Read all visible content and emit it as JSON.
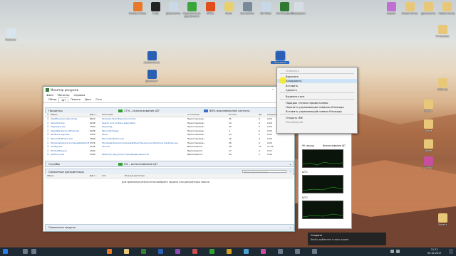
{
  "desktop_icons_top": [
    {
      "label": "Корзина",
      "color": "#9aa6b2"
    },
    {
      "label": "Mozilla Firefox",
      "color": "#e8782a"
    },
    {
      "label": "7-Zip",
      "color": "#222222"
    },
    {
      "label": "Документы",
      "color": "#c9d9e8"
    },
    {
      "label": "Подключение удалённого",
      "color": "#3aa53a"
    },
    {
      "label": "Office",
      "color": "#e24e1b"
    },
    {
      "label": "Кино",
      "color": "#e8d070"
    },
    {
      "label": "Настройки",
      "color": "#7a8a9a"
    },
    {
      "label": "HD Video",
      "color": "#c8d8e8"
    },
    {
      "label": "Фотографии",
      "color": "#2f7a2f"
    },
    {
      "label": "Проводник",
      "color": "#d7dde4"
    },
    {
      "label": "Copilot",
      "color": "#c070d0"
    },
    {
      "label": "Новая папка",
      "color": "#e8c878"
    },
    {
      "label": "Документы",
      "color": "#e8c878"
    },
    {
      "label": "Новая папка",
      "color": "#e8c878"
    }
  ],
  "desktop_icons_right": [
    {
      "label": "Установка",
      "color": "#e8c878"
    },
    {
      "label": "Рабочая",
      "color": "#e8c878"
    },
    {
      "label": "Ярлык",
      "color": "#e8c878"
    },
    {
      "label": "Папка",
      "color": "#e8c878"
    },
    {
      "label": "Архив",
      "color": "#e8c878"
    },
    {
      "label": "WinRAR",
      "color": "#c84fa0"
    },
    {
      "label": "Проект",
      "color": "#e8c878"
    }
  ],
  "desktop_word_1": "приложение",
  "desktop_word_2": "Документ",
  "desktop_word_sel": "Документ",
  "resource_monitor": {
    "title": "Монитор ресурсов",
    "menu": [
      "Файл",
      "Монитор",
      "Справка"
    ],
    "tabs": [
      "Обзор",
      "ЦП",
      "Память",
      "Диск",
      "Сеть"
    ],
    "active_tab": "ЦП",
    "processes": {
      "label": "Процессы",
      "cpu_usage": "17% - использование ЦП",
      "max_freq": "66% максимальной частоты",
      "columns": [
        "Образ",
        "ИД п...",
        "Описание",
        "Состояние",
        "Потоки",
        "ЦП",
        "Среднее..."
      ],
      "rows": [
        [
          "ShellExperienceHost.exe",
          "6624",
          "Windows Shell Experience Host",
          "Приостановле...",
          "45",
          "0",
          "0.00"
        ],
        [
          "SearchUI.exe",
          "6208",
          "Search and Cortana application",
          "Приостановле...",
          "34",
          "0",
          "0.00"
        ],
        [
          "Skypeapp.exe",
          "7564",
          "Skypeapp",
          "Приостановле...",
          "35",
          "0",
          "0.00"
        ],
        [
          "SkypeBackgroundHost.exe",
          "4028",
          "Microsoft Skype",
          "Приостановле...",
          "4",
          "0",
          "0.00"
        ],
        [
          "WinStore.App.exe",
          "4420",
          "Store",
          "Приостановле...",
          "13",
          "0",
          "0.00"
        ],
        [
          "Microsoft.Photos.exe",
          "1896",
          "Microsoft.Photos.exe",
          "Приостановле...",
          "16",
          "0",
          "0.00"
        ],
        [
          "WindowsInternal.ComposableShell.Experiences.TextInput.InputApp.exe",
          "4376",
          "WindowsInternal.ComposableShell.Experiences.TextInput.InputApp.exe",
          "Приостановле...",
          "26",
          "0",
          "0.00"
        ],
        [
          "dxdiag.exe",
          "4796",
          "DirectX",
          "Выполняется",
          "16",
          "11",
          "11.29"
        ],
        [
          "HiddenPlay.exe",
          "1592",
          "",
          "Выполняется",
          "17",
          "2",
          "0.31"
        ],
        [
          "perfmon.exe",
          "4440",
          "Монитор ресурсов и производительности",
          "Выполняется",
          "20",
          "1",
          "0.44"
        ]
      ]
    },
    "services": {
      "label": "Службы",
      "cpu_usage": "0% - использование ЦП"
    },
    "handles": {
      "label": "Связанные дескрипторы",
      "search_placeholder": "Поиск дескрипторов",
      "columns": [
        "Образ",
        "ИД п...",
        "Тип",
        "Имя дескриптора"
      ],
      "empty_text": "Для просмотра результатов выберите процесс или дескрипторы поиска."
    },
    "modules": {
      "label": "Связанные модули"
    }
  },
  "context_menu": {
    "items": [
      {
        "label": "Отменить",
        "disabled": true
      },
      {
        "label": "Вырезать",
        "disabled": false
      },
      {
        "label": "Копировать",
        "disabled": false,
        "highlighted": true
      },
      {
        "label": "Вставить",
        "disabled": false
      },
      {
        "label": "Удалить",
        "disabled": false
      },
      {
        "label": "Выделить все",
        "disabled": false
      },
      {
        "label": "Порядок чтения справа налево",
        "disabled": false
      },
      {
        "label": "Показать управляющие символы Юникода",
        "disabled": false
      },
      {
        "label": "Вставить управляющий символ Юникода",
        "disabled": false
      },
      {
        "label": "Открыть IME",
        "disabled": false
      },
      {
        "label": "Реконверсия",
        "disabled": true
      }
    ]
  },
  "graphs": {
    "labels": [
      "ЦП 0",
      "90 секунд",
      "Использование ЦП",
      "ЦП 1",
      "ЦП 2"
    ],
    "values": [
      "100%",
      "100%",
      "0%",
      "100%",
      "0%"
    ]
  },
  "notification": {
    "title": "Создано",
    "text": "Файл добавлен в ваш архив"
  },
  "clock": {
    "time": "11:11",
    "date": "05.12.2017"
  },
  "accent_colors": {
    "taskbar": "#1d2a34",
    "highlight": "#cde3f7",
    "link": "#2764b8"
  }
}
